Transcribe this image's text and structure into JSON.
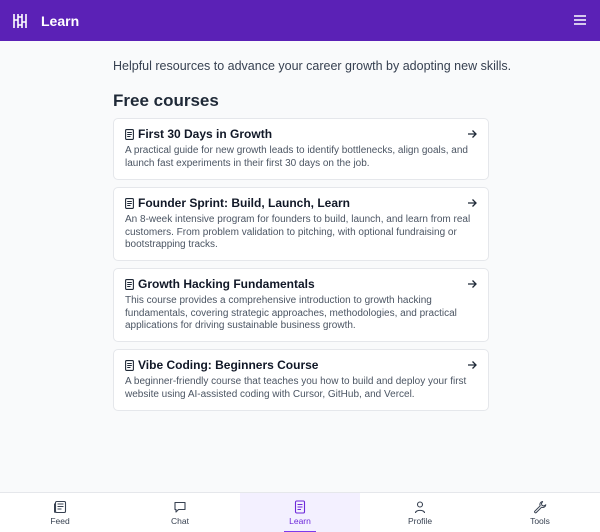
{
  "header": {
    "title": "Learn",
    "logo": "hashtag-logo-icon",
    "menu_icon": "hamburger-menu-icon",
    "bg_color": "#5b21b6"
  },
  "main": {
    "intro": "Helpful resources to advance your career growth by adopting new skills.",
    "section_title": "Free courses",
    "courses": [
      {
        "title": "First 30 Days in Growth",
        "description": "A practical guide for new growth leads to identify bottlenecks, align goals, and launch fast experiments in their first 30 days on the job."
      },
      {
        "title": "Founder Sprint: Build, Launch, Learn",
        "description": "An 8-week intensive program for founders to build, launch, and learn from real customers. From problem validation to pitching, with optional fundraising or bootstrapping tracks."
      },
      {
        "title": "Growth Hacking Fundamentals",
        "description": "This course provides a comprehensive introduction to growth hacking fundamentals, covering strategic approaches, methodologies, and practical applications for driving sustainable business growth."
      },
      {
        "title": "Vibe Coding: Beginners Course",
        "description": "A beginner-friendly course that teaches you how to build and deploy your first website using AI-assisted coding with Cursor, GitHub, and Vercel."
      }
    ]
  },
  "bottom_nav": {
    "active_tab": "Learn",
    "accent_color": "#7c3aed",
    "items": [
      {
        "label": "Feed",
        "icon": "newspaper-icon"
      },
      {
        "label": "Chat",
        "icon": "chat-bubble-icon"
      },
      {
        "label": "Learn",
        "icon": "book-icon"
      },
      {
        "label": "Profile",
        "icon": "user-icon"
      },
      {
        "label": "Tools",
        "icon": "wrench-icon"
      }
    ]
  }
}
